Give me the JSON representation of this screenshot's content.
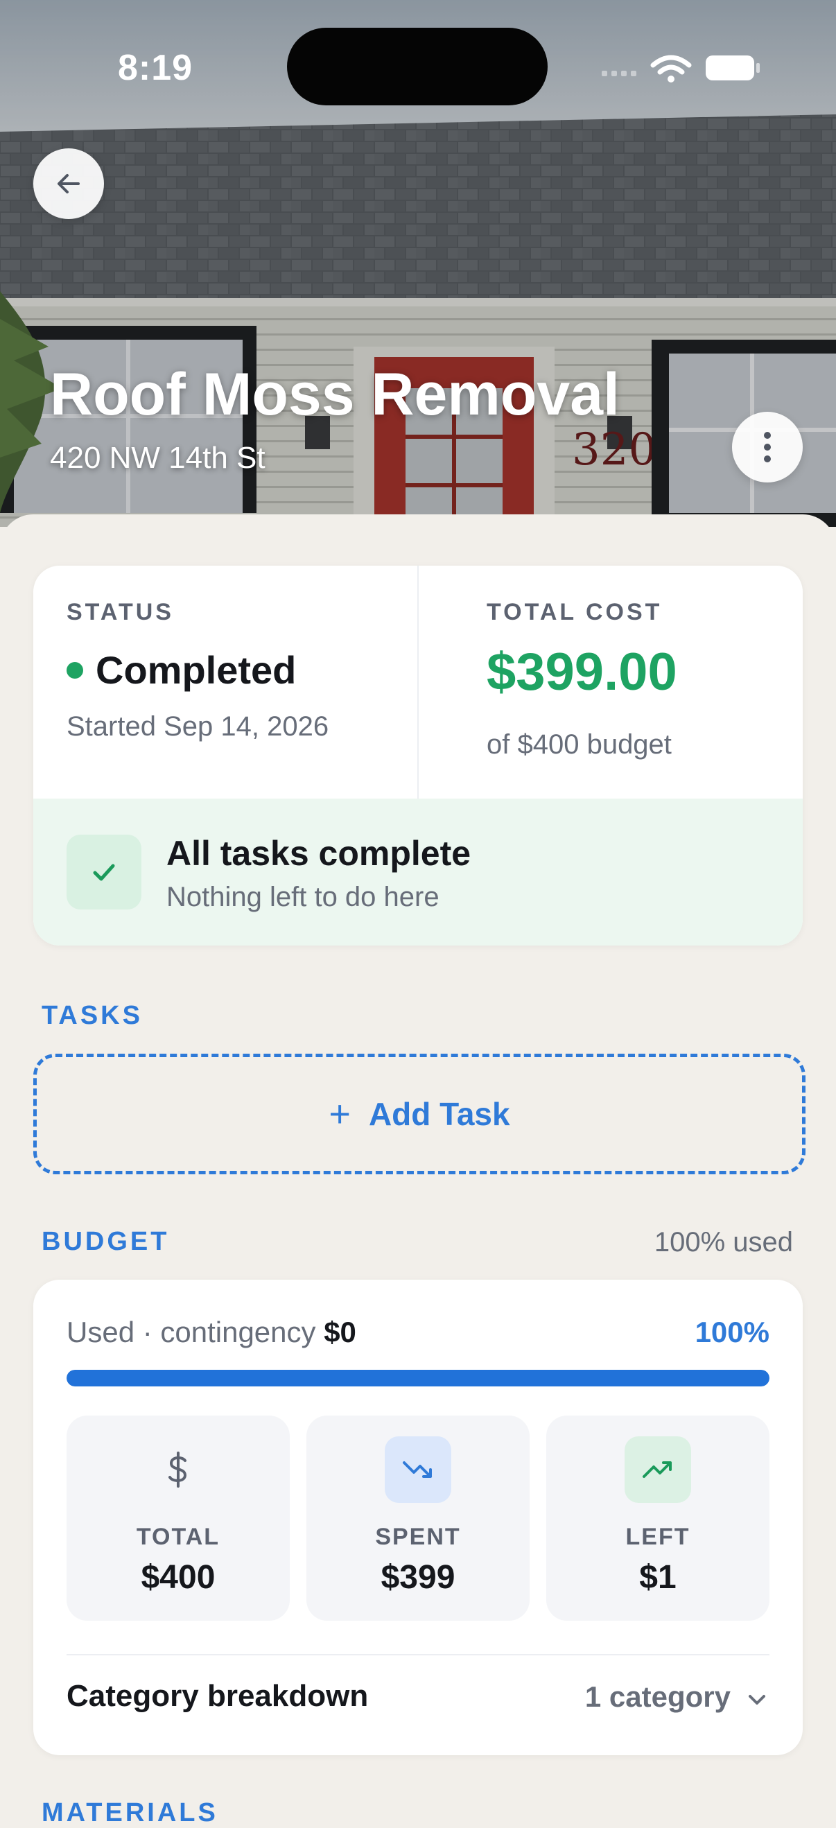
{
  "status_bar": {
    "time": "8:19"
  },
  "hero": {
    "title": "Roof Moss Removal",
    "address": "420 NW 14th St",
    "house_number": "320"
  },
  "summary": {
    "status_label": "STATUS",
    "status_value": "Completed",
    "started": "Started Sep 14, 2026",
    "cost_label": "TOTAL COST",
    "cost_value": "$399.00",
    "cost_sub": "of $400 budget",
    "complete_title": "All tasks complete",
    "complete_sub": "Nothing left to do here"
  },
  "tasks": {
    "section_title": "TASKS",
    "add_plus": "+",
    "add_label": "Add Task"
  },
  "budget": {
    "section_title": "BUDGET",
    "used_summary": "100% used",
    "used_prefix": "Used · contingency",
    "contingency": "$0",
    "percent_label": "100%",
    "progress_fraction": 1.0,
    "stats": [
      {
        "label": "TOTAL",
        "value": "$400",
        "icon": "dollar-icon"
      },
      {
        "label": "SPENT",
        "value": "$399",
        "icon": "trending-down-icon"
      },
      {
        "label": "LEFT",
        "value": "$1",
        "icon": "trending-up-icon"
      }
    ],
    "category_title": "Category breakdown",
    "category_count": "1 category"
  },
  "materials": {
    "section_title": "MATERIALS"
  },
  "colors": {
    "accent": "#2f7ad8",
    "success": "#1ea362",
    "background": "#f2efea"
  }
}
